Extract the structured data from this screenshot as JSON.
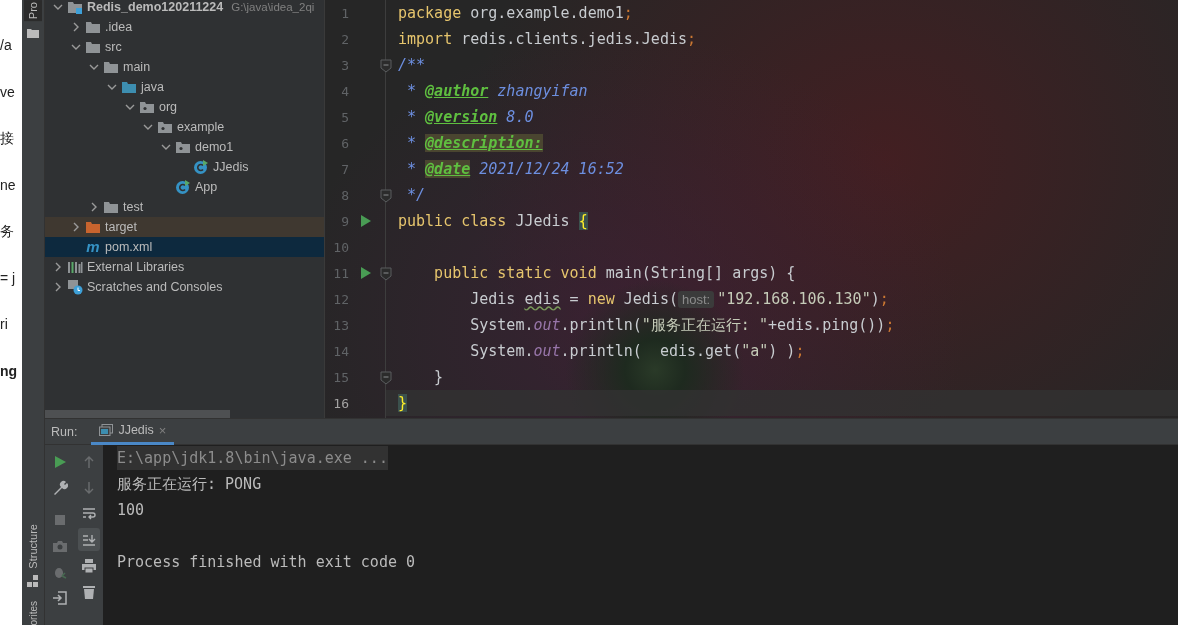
{
  "background_page": {
    "fragments": [
      {
        "text": "/a",
        "bold": false
      },
      {
        "text": "ve",
        "bold": false
      },
      {
        "text": "接",
        "bold": false
      },
      {
        "text": "ne",
        "bold": false
      },
      {
        "text": "务",
        "bold": false
      },
      {
        "text": "= j",
        "bold": false
      },
      {
        "text": "ri",
        "bold": false
      },
      {
        "text": "ng",
        "bold": true
      }
    ]
  },
  "tool_strip": {
    "top_tab": "Pro",
    "middle_tab": "Structure",
    "bottom_tab": "orites"
  },
  "project_tree": [
    {
      "label": "Redis_demo120211224",
      "path": "G:\\java\\idea_2qi",
      "kind": "module",
      "expanded": true,
      "selected": false,
      "children": [
        {
          "label": ".idea",
          "kind": "folder",
          "expanded": false,
          "selected": false
        },
        {
          "label": "src",
          "kind": "folder",
          "expanded": true,
          "selected": false,
          "children": [
            {
              "label": "main",
              "kind": "folder",
              "expanded": true,
              "selected": false,
              "children": [
                {
                  "label": "java",
                  "kind": "source",
                  "expanded": true,
                  "selected": false,
                  "children": [
                    {
                      "label": "org",
                      "kind": "package",
                      "expanded": true,
                      "selected": false,
                      "children": [
                        {
                          "label": "example",
                          "kind": "package",
                          "expanded": true,
                          "selected": false,
                          "children": [
                            {
                              "label": "demo1",
                              "kind": "package",
                              "expanded": true,
                              "selected": false,
                              "children": [
                                {
                                  "label": "JJedis",
                                  "kind": "class",
                                  "selected": false
                                }
                              ]
                            },
                            {
                              "label": "App",
                              "kind": "class",
                              "selected": false
                            }
                          ]
                        }
                      ]
                    }
                  ]
                }
              ]
            },
            {
              "label": "test",
              "kind": "folder",
              "expanded": false,
              "selected": false
            }
          ]
        },
        {
          "label": "target",
          "kind": "excluded",
          "expanded": false,
          "selected": false
        },
        {
          "label": "pom.xml",
          "kind": "maven",
          "icon_text": "m",
          "selected": true
        }
      ]
    },
    {
      "label": "External Libraries",
      "kind": "libraries",
      "expanded": false,
      "selected": false
    },
    {
      "label": "Scratches and Consoles",
      "kind": "scratches",
      "expanded": false,
      "selected": false
    }
  ],
  "editor": {
    "lines": [
      {
        "number": "1",
        "tokens": [
          {
            "text": "package",
            "kind": "kw"
          },
          {
            "text": " org.example.demo1",
            "kind": "plain"
          },
          {
            "text": ";",
            "kind": "semi"
          }
        ]
      },
      {
        "number": "2",
        "tokens": [
          {
            "text": "import",
            "kind": "kw"
          },
          {
            "text": " redis.clients.jedis.Jedis",
            "kind": "plain"
          },
          {
            "text": ";",
            "kind": "semi"
          }
        ]
      },
      {
        "number": "3",
        "fold": true,
        "tokens": [
          {
            "text": "/**",
            "kind": "doc"
          }
        ]
      },
      {
        "number": "4",
        "tokens": [
          {
            "text": " * ",
            "kind": "doc"
          },
          {
            "text": "@author",
            "kind": "tag"
          },
          {
            "text": " zhangyifan",
            "kind": "doc"
          }
        ]
      },
      {
        "number": "5",
        "tokens": [
          {
            "text": " * ",
            "kind": "doc"
          },
          {
            "text": "@version",
            "kind": "tag"
          },
          {
            "text": " 8.0",
            "kind": "doc"
          }
        ]
      },
      {
        "number": "6",
        "tokens": [
          {
            "text": " * ",
            "kind": "doc"
          },
          {
            "text": "@description:",
            "kind": "marked"
          }
        ]
      },
      {
        "number": "7",
        "tokens": [
          {
            "text": " * ",
            "kind": "doc"
          },
          {
            "text": "@date",
            "kind": "marked"
          },
          {
            "text": " 2021/12/24 16:52",
            "kind": "doc"
          }
        ]
      },
      {
        "number": "8",
        "fold": true,
        "tokens": [
          {
            "text": " */",
            "kind": "doc"
          }
        ]
      },
      {
        "number": "9",
        "run": true,
        "tokens": [
          {
            "text": "public class",
            "kind": "kw"
          },
          {
            "text": " JJedis ",
            "kind": "plain"
          },
          {
            "text": "{",
            "kind": "brace"
          }
        ]
      },
      {
        "number": "10"
      },
      {
        "number": "11",
        "run": true,
        "fold": true,
        "tokens": [
          {
            "text": "    public static void",
            "kind": "kw"
          },
          {
            "text": " main(String[] args) {",
            "kind": "plain"
          }
        ]
      },
      {
        "number": "12",
        "tokens": [
          {
            "text": "        Jedis ",
            "kind": "plain"
          },
          {
            "text": "edis",
            "kind": "warn"
          },
          {
            "text": " = ",
            "kind": "plain"
          },
          {
            "text": "new",
            "kind": "kw"
          },
          {
            "text": " Jedis(",
            "kind": "plain"
          },
          {
            "text": "host:",
            "kind": "hint"
          },
          {
            "text": "\"192.168.106.130\"",
            "kind": "string"
          },
          {
            "text": ")",
            "kind": "plain"
          },
          {
            "text": ";",
            "kind": "semi"
          }
        ]
      },
      {
        "number": "13",
        "tokens": [
          {
            "text": "        System.",
            "kind": "plain"
          },
          {
            "text": "out",
            "kind": "field"
          },
          {
            "text": ".println(",
            "kind": "plain"
          },
          {
            "text": "\"服务正在运行: \"",
            "kind": "string"
          },
          {
            "text": "+edis.ping())",
            "kind": "plain"
          },
          {
            "text": ";",
            "kind": "semi"
          }
        ]
      },
      {
        "number": "14",
        "tokens": [
          {
            "text": "        System.",
            "kind": "plain"
          },
          {
            "text": "out",
            "kind": "field"
          },
          {
            "text": ".println(  edis.get(",
            "kind": "plain"
          },
          {
            "text": "\"a\"",
            "kind": "string"
          },
          {
            "text": ") )",
            "kind": "plain"
          },
          {
            "text": ";",
            "kind": "semi"
          }
        ]
      },
      {
        "number": "15",
        "fold": true,
        "tokens": [
          {
            "text": "    }",
            "kind": "plain"
          }
        ]
      },
      {
        "number": "16",
        "current": true,
        "tokens": [
          {
            "text": "}",
            "kind": "brace"
          }
        ]
      }
    ]
  },
  "run_panel": {
    "label": "Run:",
    "tabs": [
      {
        "label": "JJedis",
        "selected": true,
        "close": "×"
      }
    ],
    "left_tools": [
      {
        "kind": "run",
        "disabled": false
      },
      {
        "kind": "wrench",
        "disabled": false
      },
      {
        "kind": "stop",
        "disabled": true
      },
      {
        "kind": "camera",
        "disabled": true
      },
      {
        "kind": "bug",
        "disabled": true
      },
      {
        "kind": "exit",
        "disabled": false
      }
    ],
    "right_tools": [
      {
        "kind": "up",
        "disabled": true
      },
      {
        "kind": "down",
        "disabled": true
      },
      {
        "kind": "wrap",
        "disabled": false,
        "on": false
      },
      {
        "kind": "scroll-end",
        "disabled": false,
        "on": true
      },
      {
        "kind": "print",
        "disabled": false,
        "on": false
      },
      {
        "kind": "trash",
        "disabled": false,
        "on": false
      }
    ],
    "console": [
      {
        "text": "E:\\app\\jdk1.8\\bin\\java.exe ...",
        "kind": "command"
      },
      {
        "text": "服务正在运行: PONG",
        "kind": "output"
      },
      {
        "text": "100",
        "kind": "output"
      },
      {
        "kind": "blank"
      },
      {
        "text": "Process finished with exit code 0",
        "kind": "output"
      }
    ]
  }
}
